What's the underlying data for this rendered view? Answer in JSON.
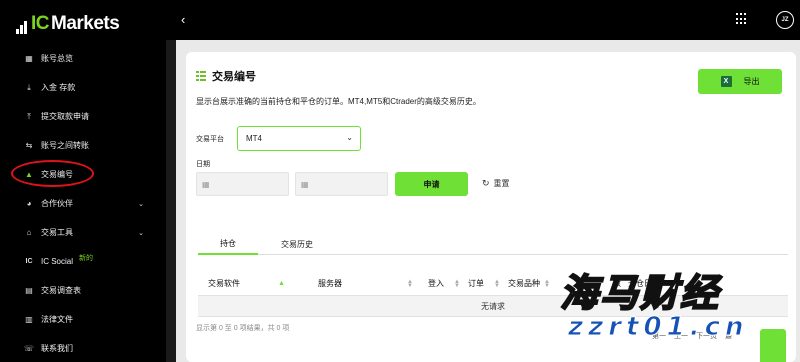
{
  "brand": {
    "prefix": "IC",
    "name": "Markets"
  },
  "sidebar": {
    "items": [
      {
        "label": "账号总览",
        "icon": "dashboard-icon"
      },
      {
        "label": "入金 存款",
        "icon": "deposit-icon"
      },
      {
        "label": "提交取款申请",
        "icon": "withdraw-icon"
      },
      {
        "label": "账号之间转账",
        "icon": "transfer-icon"
      },
      {
        "label": "交易编号",
        "icon": "chart-icon"
      },
      {
        "label": "合作伙伴",
        "icon": "partner-icon"
      },
      {
        "label": "交易工具",
        "icon": "tools-icon"
      },
      {
        "label": "IC Social",
        "icon": "ic-social-icon",
        "badge": "新的"
      },
      {
        "label": "交易调查表",
        "icon": "survey-icon"
      },
      {
        "label": "法律文件",
        "icon": "legal-icon"
      },
      {
        "label": "联系我们",
        "icon": "contact-icon"
      }
    ]
  },
  "topbar": {
    "back": "‹",
    "avatar": "JZ"
  },
  "page": {
    "title": "交易编号",
    "export_label": "导出",
    "xls": "X",
    "description": "显示台展示准确的当前持仓和平仓的订单。MT4,MT5和Ctrader的高级交易历史。",
    "platform_label": "交易平台",
    "platform_value": "MT4",
    "date_label": "日期",
    "apply_label": "申请",
    "reset_label": "重置"
  },
  "tabs": [
    {
      "label": "持仓"
    },
    {
      "label": "交易历史"
    }
  ],
  "table": {
    "headers": [
      "交易软件",
      "服务器",
      "登入",
      "订单",
      "交易品种",
      "数",
      "开仓日期"
    ],
    "empty_text": "无请求",
    "footer": "显示第 0 至 0 项结果，共 0 项",
    "pager": [
      "第一",
      "上一",
      "下一页",
      "最"
    ]
  },
  "watermark": {
    "cn": "海马财经",
    "url": "zzrt01.cn"
  },
  "colors": {
    "accent": "#6ee036",
    "sidebar_bg": "#000000",
    "highlight_ring": "#e0131b"
  }
}
